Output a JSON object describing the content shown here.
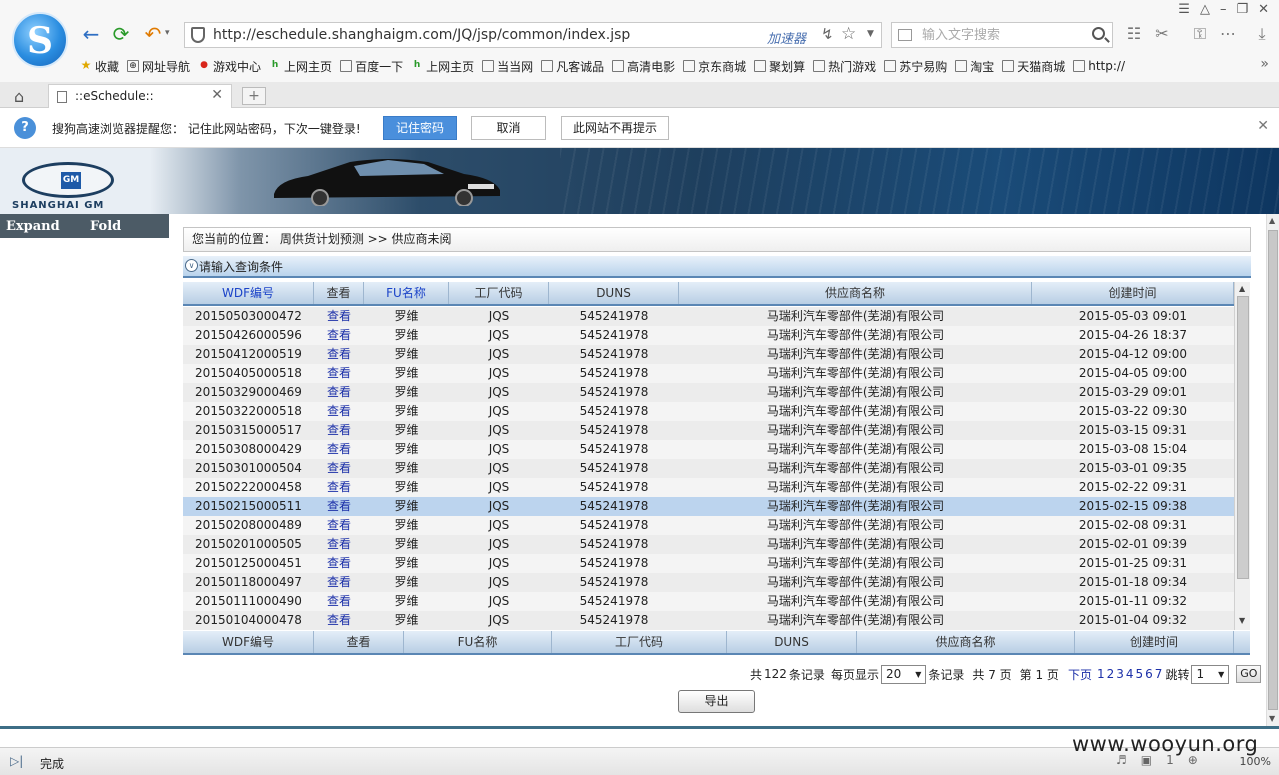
{
  "browser": {
    "url": "http://eschedule.shanghaigm.com/JQ/jsp/common/index.jsp",
    "accelerator_label": "加速器",
    "search_placeholder": "输入文字搜索",
    "tab_title": "::eSchedule::",
    "status_text": "完成",
    "zoom": "100%",
    "status_count": "1",
    "bookmarks": [
      {
        "label": "收藏",
        "icon": "star-icon"
      },
      {
        "label": "网址导航",
        "icon": "globe-icon"
      },
      {
        "label": "游戏中心",
        "icon": "game-icon"
      },
      {
        "label": "上网主页",
        "icon": "hao-icon"
      },
      {
        "label": "百度一下",
        "icon": "page-icon"
      },
      {
        "label": "上网主页",
        "icon": "hao-icon"
      },
      {
        "label": "当当网",
        "icon": "page-icon"
      },
      {
        "label": "凡客诚品",
        "icon": "page-icon"
      },
      {
        "label": "高清电影",
        "icon": "page-icon"
      },
      {
        "label": "京东商城",
        "icon": "page-icon"
      },
      {
        "label": "聚划算",
        "icon": "page-icon"
      },
      {
        "label": "热门游戏",
        "icon": "page-icon"
      },
      {
        "label": "苏宁易购",
        "icon": "page-icon"
      },
      {
        "label": "淘宝",
        "icon": "page-icon"
      },
      {
        "label": "天猫商城",
        "icon": "page-icon"
      },
      {
        "label": "http://",
        "icon": "page-icon"
      }
    ]
  },
  "notice": {
    "text": "搜狗高速浏览器提醒您： 记住此网站密码，下次一键登录!",
    "remember_label": "记住密码",
    "cancel_label": "取消",
    "never_label": "此网站不再提示"
  },
  "banner": {
    "brand_text": "SHANGHAI GM",
    "logo_text": "GM"
  },
  "sidebar": {
    "expand_label": "Expand",
    "fold_label": "Fold"
  },
  "breadcrumb": "您当前的位置： 周供货计划预测 >> 供应商未阅",
  "query_label": "请输入查询条件",
  "grid": {
    "columns": [
      "WDF编号",
      "查看",
      "FU名称",
      "工厂代码",
      "DUNS",
      "供应商名称",
      "创建时间"
    ],
    "footer_columns": [
      "WDF编号",
      "查看",
      "FU名称",
      "工厂代码",
      "DUNS",
      "供应商名称",
      "创建时间"
    ],
    "rows": [
      [
        "20150503000472",
        "查看",
        "罗维",
        "JQS",
        "545241978",
        "马瑞利汽车零部件(芜湖)有限公司",
        "2015-05-03 09:01"
      ],
      [
        "20150426000596",
        "查看",
        "罗维",
        "JQS",
        "545241978",
        "马瑞利汽车零部件(芜湖)有限公司",
        "2015-04-26 18:37"
      ],
      [
        "20150412000519",
        "查看",
        "罗维",
        "JQS",
        "545241978",
        "马瑞利汽车零部件(芜湖)有限公司",
        "2015-04-12 09:00"
      ],
      [
        "20150405000518",
        "查看",
        "罗维",
        "JQS",
        "545241978",
        "马瑞利汽车零部件(芜湖)有限公司",
        "2015-04-05 09:00"
      ],
      [
        "20150329000469",
        "查看",
        "罗维",
        "JQS",
        "545241978",
        "马瑞利汽车零部件(芜湖)有限公司",
        "2015-03-29 09:01"
      ],
      [
        "20150322000518",
        "查看",
        "罗维",
        "JQS",
        "545241978",
        "马瑞利汽车零部件(芜湖)有限公司",
        "2015-03-22 09:30"
      ],
      [
        "20150315000517",
        "查看",
        "罗维",
        "JQS",
        "545241978",
        "马瑞利汽车零部件(芜湖)有限公司",
        "2015-03-15 09:31"
      ],
      [
        "20150308000429",
        "查看",
        "罗维",
        "JQS",
        "545241978",
        "马瑞利汽车零部件(芜湖)有限公司",
        "2015-03-08 15:04"
      ],
      [
        "20150301000504",
        "查看",
        "罗维",
        "JQS",
        "545241978",
        "马瑞利汽车零部件(芜湖)有限公司",
        "2015-03-01 09:35"
      ],
      [
        "20150222000458",
        "查看",
        "罗维",
        "JQS",
        "545241978",
        "马瑞利汽车零部件(芜湖)有限公司",
        "2015-02-22 09:31"
      ],
      [
        "20150215000511",
        "查看",
        "罗维",
        "JQS",
        "545241978",
        "马瑞利汽车零部件(芜湖)有限公司",
        "2015-02-15 09:38"
      ],
      [
        "20150208000489",
        "查看",
        "罗维",
        "JQS",
        "545241978",
        "马瑞利汽车零部件(芜湖)有限公司",
        "2015-02-08 09:31"
      ],
      [
        "20150201000505",
        "查看",
        "罗维",
        "JQS",
        "545241978",
        "马瑞利汽车零部件(芜湖)有限公司",
        "2015-02-01 09:39"
      ],
      [
        "20150125000451",
        "查看",
        "罗维",
        "JQS",
        "545241978",
        "马瑞利汽车零部件(芜湖)有限公司",
        "2015-01-25 09:31"
      ],
      [
        "20150118000497",
        "查看",
        "罗维",
        "JQS",
        "545241978",
        "马瑞利汽车零部件(芜湖)有限公司",
        "2015-01-18 09:34"
      ],
      [
        "20150111000490",
        "查看",
        "罗维",
        "JQS",
        "545241978",
        "马瑞利汽车零部件(芜湖)有限公司",
        "2015-01-11 09:32"
      ],
      [
        "20150104000478",
        "查看",
        "罗维",
        "JQS",
        "545241978",
        "马瑞利汽车零部件(芜湖)有限公司",
        "2015-01-04 09:32"
      ]
    ],
    "selected_row_index": 10
  },
  "pager": {
    "total_prefix": "共",
    "total_count": "122",
    "total_suffix": "条记录",
    "per_page_label": "每页显示",
    "per_page_value": "20",
    "per_page_suffix": "条记录",
    "pages_text": "共 7 页",
    "current_text": "第 1 页",
    "next_label": "下页",
    "page_links": [
      "1",
      "2",
      "3",
      "4",
      "5",
      "6",
      "7"
    ],
    "jump_label": "跳转",
    "jump_value": "1",
    "go_label": "GO"
  },
  "export_label": "导出",
  "watermark": "www.wooyun.org",
  "colors": {
    "selected_row": "#bcd4ee",
    "link_blue": "#1b2fa8",
    "header_gradient_bottom": "#b8cee4"
  }
}
